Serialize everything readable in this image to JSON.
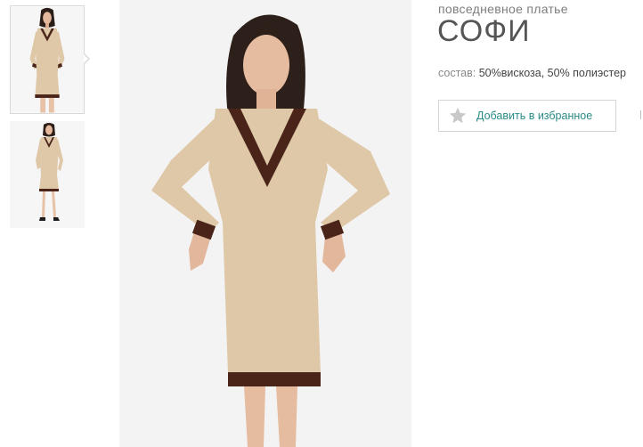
{
  "product": {
    "category": "повседневное платье",
    "title": "СОФИ",
    "composition_label": "состав:",
    "composition_value": "50%вискоза, 50% полиэстер",
    "favorite_label": "Добавить в избранное"
  },
  "colors": {
    "accent": "#2a8a86",
    "dress_main": "#dfc8a8",
    "dress_trim": "#4a2418",
    "star": "#c8c8c8"
  },
  "gallery": {
    "thumbnail_count": 2,
    "selected_index": 0
  }
}
